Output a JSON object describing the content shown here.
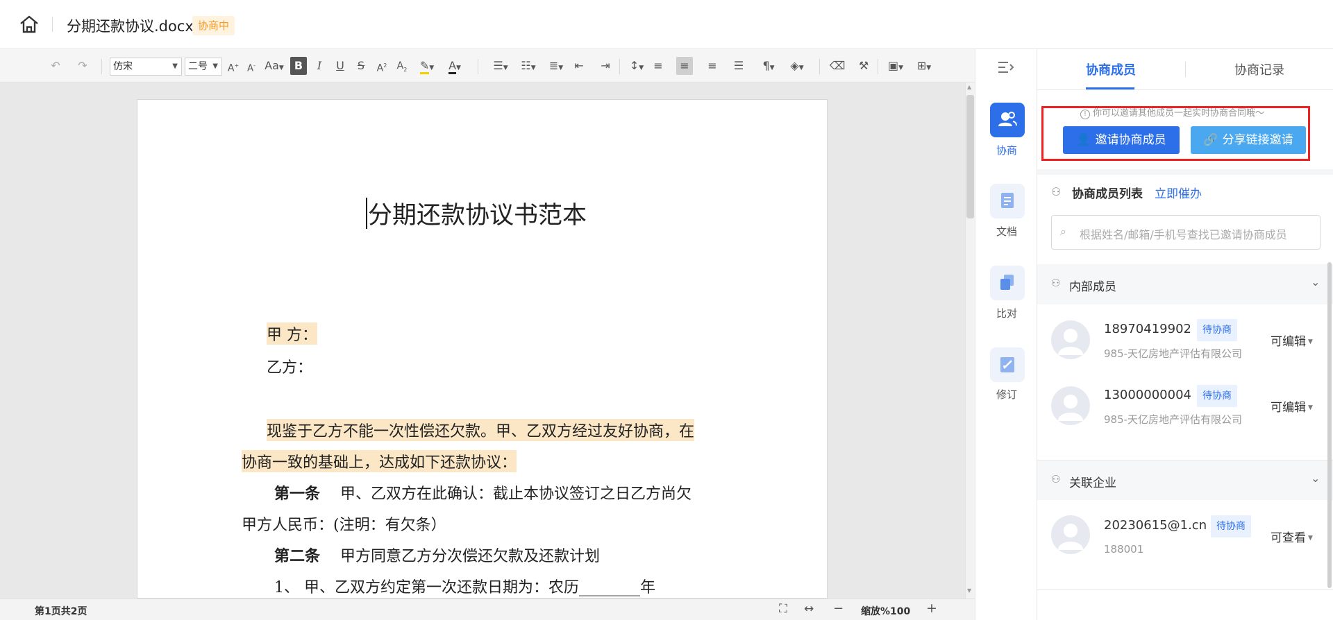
{
  "header": {
    "doc_title": "分期还款协议.docx",
    "status_badge": "协商中"
  },
  "toolbar": {
    "font_family": "仿宋",
    "font_size": "二号"
  },
  "document": {
    "heading": "分期还款协议书范本",
    "party_a": "甲  方：",
    "party_b": "乙方：",
    "intro_line1": "现鉴于乙方不能一次性偿还欠款。甲、乙双方经过友好协商，在",
    "intro_line2": "协商一致的基础上，达成如下还款协议：",
    "art1_title": "第一条",
    "art1_line1": "甲、乙双方在此确认：截止本协议签订之日乙方尚欠",
    "art1_line2": "甲方人民币：(注明：有欠条）",
    "art2_title": "第二条",
    "art2_text": "甲方同意乙方分次偿还欠款及还款计划",
    "item1": "1、 甲、乙双方约定第一次还款日期为：农历________年"
  },
  "statusbar": {
    "page_info": "第1页共2页",
    "zoom": "缩放%100"
  },
  "rail": {
    "items": [
      {
        "label": "协商"
      },
      {
        "label": "文档"
      },
      {
        "label": "比对"
      },
      {
        "label": "修订"
      }
    ]
  },
  "panel": {
    "tab_members": "协商成员",
    "tab_records": "协商记录",
    "tip": "你可以邀请其他成员一起实时协商合同哦～",
    "invite_button": "邀请协商成员",
    "share_button": "分享链接邀请",
    "list_title": "协商成员列表",
    "urge_link": "立即催办",
    "search_placeholder": "根据姓名/邮箱/手机号查找已邀请协商成员",
    "internal_section": "内部成员",
    "internal_members": [
      {
        "name": "18970419902",
        "badge": "待协商",
        "org": "985-天亿房地产评估有限公司",
        "permission": "可编辑"
      },
      {
        "name": "13000000004",
        "badge": "待协商",
        "org": "985-天亿房地产评估有限公司",
        "permission": "可编辑"
      }
    ],
    "related_section": "关联企业",
    "related_members": [
      {
        "name": "20230615@1.cn",
        "badge": "待协商",
        "org": "188001",
        "permission": "可查看"
      }
    ]
  },
  "colors": {
    "accent": "#2c6fe8",
    "share": "#4aa8f0",
    "badge_orange": "#f59a23",
    "highlight": "#fbe7c6"
  }
}
